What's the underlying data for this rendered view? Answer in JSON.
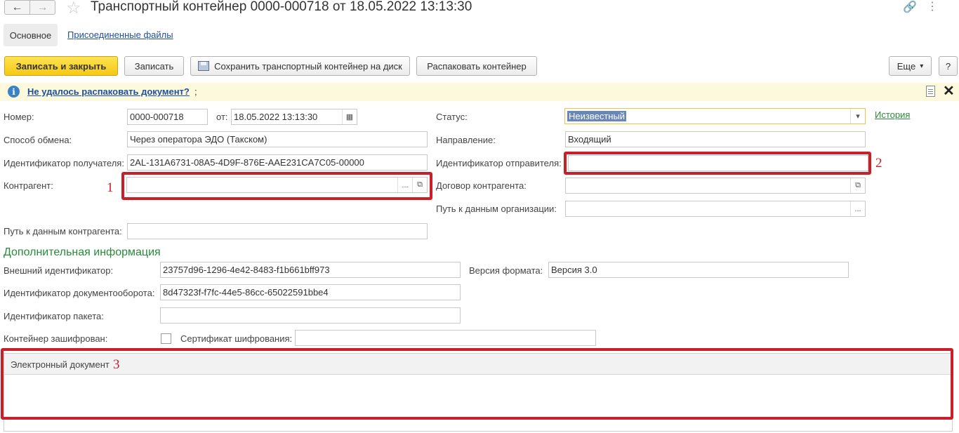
{
  "window": {
    "title": "Транспортный контейнер 0000-000718 от 18.05.2022 13:13:30",
    "back_icon": "←",
    "forward_icon": "→",
    "favorite_icon": "☆",
    "link_icon": "🔗",
    "more_icon": "⋮"
  },
  "tabs": {
    "main": "Основное",
    "files": "Присоединенные файлы"
  },
  "toolbar": {
    "save_close": "Записать и закрыть",
    "save": "Записать",
    "save_to_disk": "Сохранить транспортный контейнер на диск",
    "unpack": "Распаковать контейнер",
    "more": "Еще",
    "more_arrow": "▾",
    "help": "?"
  },
  "info": {
    "icon": "i",
    "message": "Не удалось распаковать документ?",
    "message_suffix": ";",
    "close": "✕"
  },
  "form": {
    "number_label": "Номер:",
    "number_value": "0000-000718",
    "date_label": "от:",
    "date_value": "18.05.2022 13:13:30",
    "status_label": "Статус:",
    "status_value": "Неизвестный",
    "history_link": "История",
    "exchange_label": "Способ обмена:",
    "exchange_value": "Через оператора ЭДО (Такском)",
    "direction_label": "Направление:",
    "direction_value": "Входящий",
    "recipient_id_label": "Идентификатор получателя:",
    "recipient_id_value": "2AL-131A6731-08A5-4D9F-876E-AAE231CA7C05-00000",
    "sender_id_label": "Идентификатор отправителя:",
    "sender_id_value": "",
    "counterparty_label": "Контрагент:",
    "counterparty_value": "",
    "contract_label": "Договор контрагента:",
    "contract_value": "",
    "org_path_label": "Путь к данным организации:",
    "org_path_value": "",
    "cp_path_label": "Путь к данным контрагента:",
    "cp_path_value": ""
  },
  "additional": {
    "section_title": "Дополнительная информация",
    "external_id_label": "Внешний идентификатор:",
    "external_id_value": "23757d96-1296-4e42-8483-f1b661bff973",
    "format_version_label": "Версия формата:",
    "format_version_value": "Версия 3.0",
    "docflow_id_label": "Идентификатор документооборота:",
    "docflow_id_value": "8d47323f-f7fc-44e5-86cc-65022591bbe4",
    "package_id_label": "Идентификатор пакета:",
    "package_id_value": "",
    "encrypted_label": "Контейнер зашифрован:",
    "encrypted_checked": false,
    "certificate_label": "Сертификат шифрования:",
    "certificate_value": ""
  },
  "table": {
    "column_title": "Электронный документ"
  },
  "annotations": {
    "marker_1": "1",
    "marker_2": "2",
    "marker_3": "3",
    "color": "#c91f2a"
  },
  "colors": {
    "primary_button": "#f6c812",
    "link": "#1e4fa1",
    "section_green": "#2a8a3a",
    "info_bar": "#fdf9dc"
  }
}
